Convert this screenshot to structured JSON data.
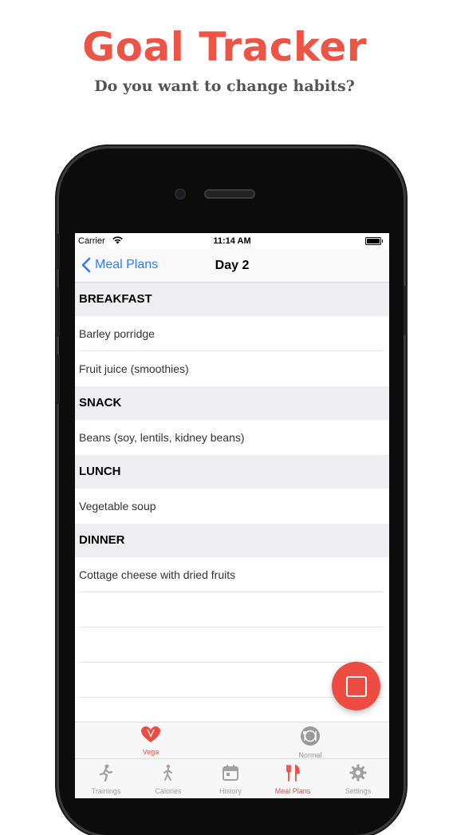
{
  "promo": {
    "title": "Goal Tracker",
    "subtitle": "Do you want to change habits?"
  },
  "status_bar": {
    "carrier": "Carrier",
    "time": "11:14 AM"
  },
  "nav": {
    "back_label": "Meal Plans",
    "title": "Day 2"
  },
  "sections": [
    {
      "header": "BREAKFAST",
      "items": [
        "Barley porridge",
        "Fruit juice (smoothies)"
      ]
    },
    {
      "header": "SNACK",
      "items": [
        "Beans (soy, lentils, kidney beans)"
      ]
    },
    {
      "header": "LUNCH",
      "items": [
        "Vegetable soup"
      ]
    },
    {
      "header": "DINNER",
      "items": [
        "Cottage cheese with dried fruits"
      ]
    }
  ],
  "segments": [
    {
      "label": "Vega",
      "icon": "heart-icon",
      "selected": true
    },
    {
      "label": "Normal",
      "icon": "plate-icon",
      "selected": false
    }
  ],
  "tabs": [
    {
      "label": "Trainings",
      "icon": "runner-icon",
      "active": false
    },
    {
      "label": "Calories",
      "icon": "walker-icon",
      "active": false
    },
    {
      "label": "History",
      "icon": "calendar-icon",
      "active": false
    },
    {
      "label": "Meal Plans",
      "icon": "cutlery-icon",
      "active": true
    },
    {
      "label": "Settings",
      "icon": "gear-icon",
      "active": false
    }
  ],
  "colors": {
    "accent": "#ec4c42",
    "link": "#2f7ef6",
    "promo_title": "#ec5446"
  }
}
